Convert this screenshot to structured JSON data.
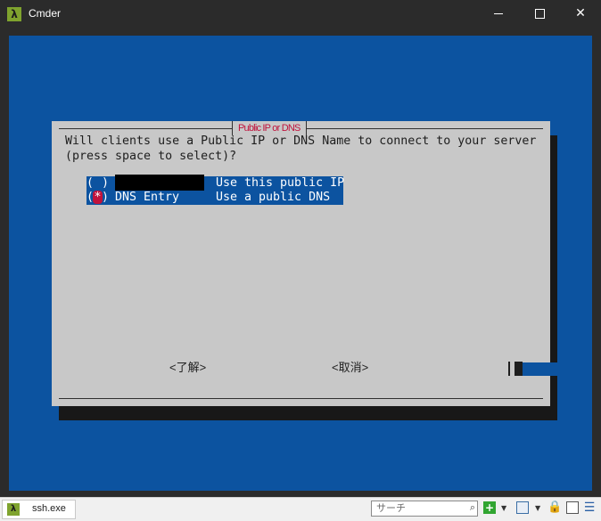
{
  "window": {
    "app_icon": "λ",
    "title": "Cmder",
    "controls": {
      "minimize": "minimize-icon",
      "maximize": "maximize-icon",
      "close": "✕"
    }
  },
  "dialog": {
    "title": "Public IP or DNS",
    "prompt_line1": "Will clients use a Public IP or DNS Name to connect to your server",
    "prompt_line2": "(press space to select)?",
    "options": [
      {
        "open": "(",
        "mark": " ",
        "close": ")",
        "tag": "",
        "description": "Use this public IP",
        "selected": false,
        "tag_redacted": true
      },
      {
        "open": "(",
        "mark": "*",
        "close": ")",
        "tag": "DNS Entry",
        "description": "Use a public DNS",
        "selected": true
      }
    ],
    "ok_button": "<了解>",
    "cancel_button": "<取消>"
  },
  "statusbar": {
    "tab_icon": "λ",
    "tab_label": "ssh.exe",
    "search_placeholder": "サーチ",
    "icons": {
      "search": "⌕",
      "new_console": "+",
      "dropdown": "▼",
      "lock": "🔒",
      "menu": "☰"
    }
  },
  "colors": {
    "terminal_bg": "#0c53a0",
    "dialog_bg": "#c8c8c8",
    "accent_red": "#c0133c",
    "titlebar_bg": "#2b2b2b"
  }
}
